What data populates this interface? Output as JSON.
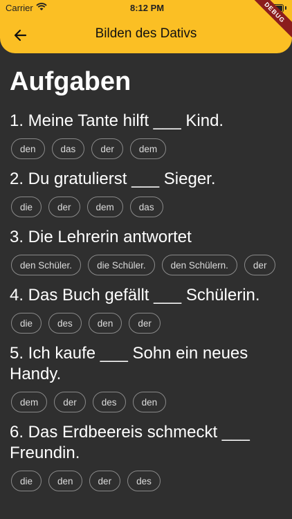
{
  "status": {
    "carrier": "Carrier",
    "time": "8:12 PM"
  },
  "appbar": {
    "title": "Bilden des Dativs"
  },
  "debug_label": "DEBUG",
  "heading": "Aufgaben",
  "questions": [
    {
      "text": "1. Meine Tante hilft ___ Kind.",
      "options": [
        "den",
        "das",
        "der",
        "dem"
      ]
    },
    {
      "text": "2. Du gratulierst ___ Sieger.",
      "options": [
        "die",
        "der",
        "dem",
        "das"
      ]
    },
    {
      "text": "3. Die Lehrerin antwortet",
      "options": [
        "den Schüler.",
        "die Schüler.",
        "den Schülern.",
        "der"
      ]
    },
    {
      "text": "4. Das Buch gefällt ___ Schülerin.",
      "options": [
        "die",
        "des",
        "den",
        "der"
      ]
    },
    {
      "text": "5. Ich kaufe ___ Sohn ein neues Handy.",
      "options": [
        "dem",
        "der",
        "des",
        "den"
      ]
    },
    {
      "text": "6. Das Erdbeereis schmeckt ___ Freundin.",
      "options": [
        "die",
        "den",
        "der",
        "des"
      ]
    }
  ]
}
